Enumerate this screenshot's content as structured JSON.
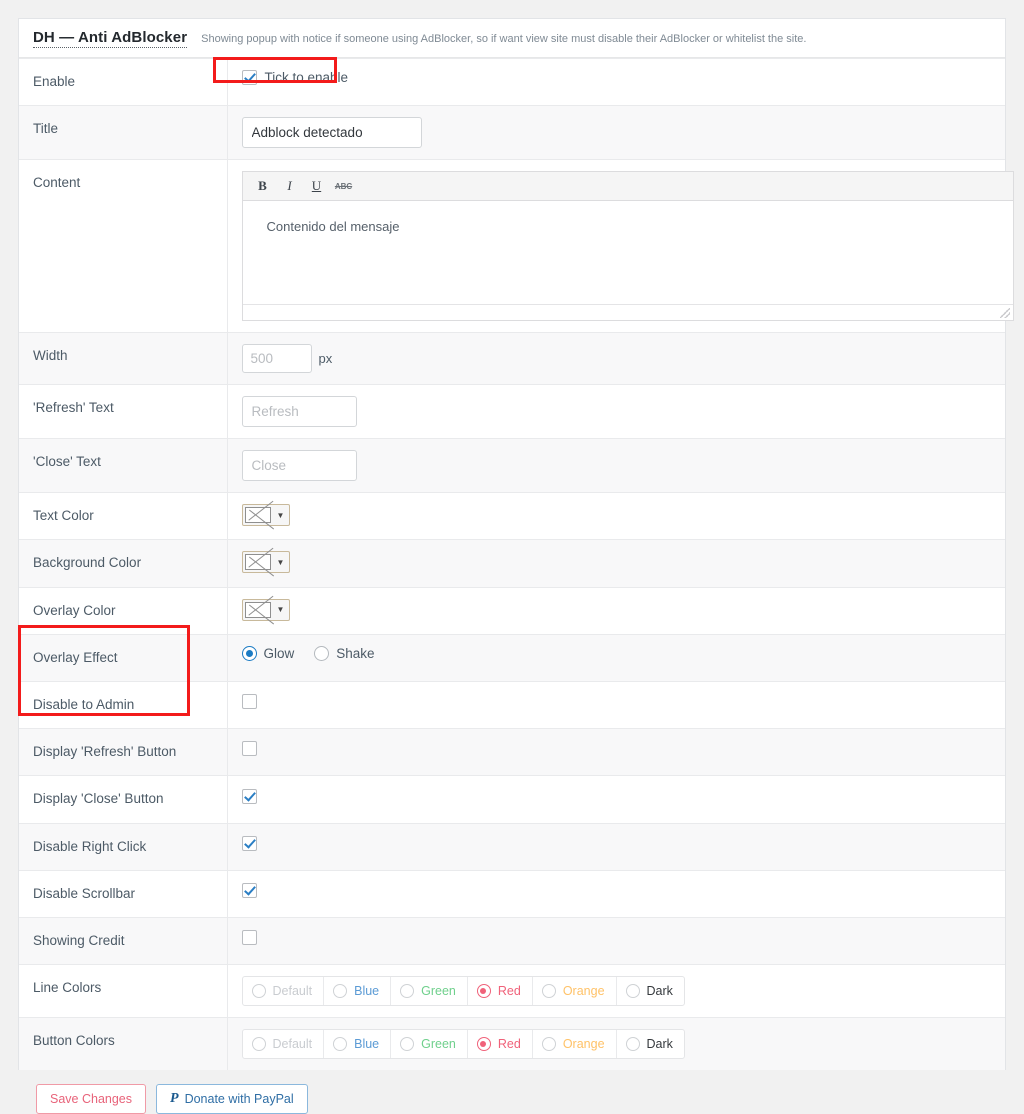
{
  "header": {
    "title": "DH — Anti AdBlocker",
    "description": "Showing popup with notice if someone using AdBlocker, so if want view site must disable their AdBlocker or whitelist the site."
  },
  "rows": {
    "enable": {
      "label": "Enable",
      "checkbox_label": "Tick to enable",
      "checked": true
    },
    "title": {
      "label": "Title",
      "value": "Adblock detectado",
      "placeholder": ""
    },
    "content": {
      "label": "Content",
      "value": "Contenido del mensaje",
      "toolbar": {
        "bold": "B",
        "italic": "I",
        "underline": "U",
        "strikethrough": "ABC"
      }
    },
    "width": {
      "label": "Width",
      "value": "",
      "placeholder": "500",
      "unit": "px"
    },
    "refresh_text": {
      "label": "'Refresh' Text",
      "value": "",
      "placeholder": "Refresh"
    },
    "close_text": {
      "label": "'Close' Text",
      "value": "",
      "placeholder": "Close"
    },
    "text_color": {
      "label": "Text Color",
      "value": ""
    },
    "background_color": {
      "label": "Background Color",
      "value": ""
    },
    "overlay_color": {
      "label": "Overlay Color",
      "value": ""
    },
    "overlay_effect": {
      "label": "Overlay Effect",
      "options": [
        "Glow",
        "Shake"
      ],
      "selected": "Glow"
    },
    "disable_admin": {
      "label": "Disable to Admin",
      "checked": false
    },
    "display_refresh": {
      "label": "Display 'Refresh' Button",
      "checked": false
    },
    "display_close": {
      "label": "Display 'Close' Button",
      "checked": true
    },
    "disable_right_click": {
      "label": "Disable Right Click",
      "checked": true
    },
    "disable_scrollbar": {
      "label": "Disable Scrollbar",
      "checked": true
    },
    "showing_credit": {
      "label": "Showing Credit",
      "checked": false
    },
    "line_colors": {
      "label": "Line Colors",
      "options": [
        "Default",
        "Blue",
        "Green",
        "Red",
        "Orange",
        "Dark"
      ],
      "selected": "Red"
    },
    "button_colors": {
      "label": "Button Colors",
      "options": [
        "Default",
        "Blue",
        "Green",
        "Red",
        "Orange",
        "Dark"
      ],
      "selected": "Red"
    }
  },
  "option_colors": {
    "Default": "#c9ccd0",
    "Blue": "#5b9bd5",
    "Green": "#6fd08c",
    "Red": "#f0627a",
    "Orange": "#ffc268",
    "Dark": "#35393d"
  },
  "footer": {
    "save_label": "Save Changes",
    "paypal_label": "Donate with PayPal",
    "paypal_icon": "P"
  }
}
